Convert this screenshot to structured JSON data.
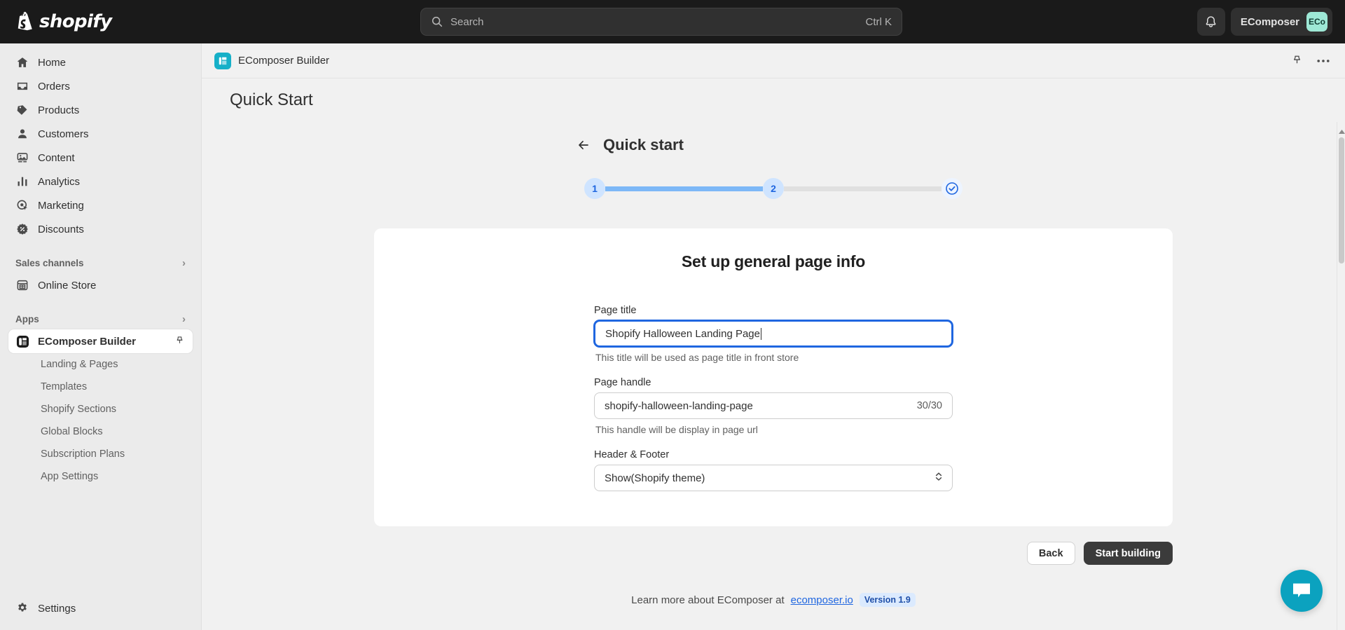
{
  "topbar": {
    "brand": "shopify",
    "search": {
      "placeholder": "Search",
      "shortcut": "Ctrl K",
      "icon": "search-icon"
    },
    "notifications_icon": "bell-icon",
    "account": {
      "name": "EComposer",
      "initials": "ECo"
    }
  },
  "sidebar": {
    "items": [
      {
        "label": "Home",
        "icon": "home-icon"
      },
      {
        "label": "Orders",
        "icon": "orders-inbox-icon"
      },
      {
        "label": "Products",
        "icon": "tag-icon"
      },
      {
        "label": "Customers",
        "icon": "person-icon"
      },
      {
        "label": "Content",
        "icon": "image-icon"
      },
      {
        "label": "Analytics",
        "icon": "bar-chart-icon"
      },
      {
        "label": "Marketing",
        "icon": "target-click-icon"
      },
      {
        "label": "Discounts",
        "icon": "discount-badge-icon"
      }
    ],
    "sales_channels": {
      "label": "Sales channels",
      "chevron": "chevron-right-icon"
    },
    "online_store": {
      "label": "Online Store",
      "icon": "storefront-icon"
    },
    "apps": {
      "label": "Apps",
      "chevron": "chevron-right-icon"
    },
    "active_app": {
      "label": "EComposer Builder",
      "icon": "ecomposer-logo-icon",
      "pin": "pin-icon"
    },
    "app_subitems": [
      {
        "label": "Landing & Pages"
      },
      {
        "label": "Templates"
      },
      {
        "label": "Shopify Sections"
      },
      {
        "label": "Global Blocks"
      },
      {
        "label": "Subscription Plans"
      },
      {
        "label": "App Settings"
      }
    ],
    "settings": {
      "label": "Settings",
      "icon": "gear-icon"
    }
  },
  "appbar": {
    "title": "EComposer Builder",
    "app_icon": "ecomposer-logo-icon",
    "pin_icon": "pin-icon",
    "more_icon": "ellipsis-horizontal-icon"
  },
  "page": {
    "title": "Quick Start",
    "quick_start_heading": "Quick start",
    "back_icon": "arrow-left-icon"
  },
  "stepper": {
    "steps": [
      {
        "label": "1",
        "state": "active"
      },
      {
        "label": "2",
        "state": "active"
      }
    ],
    "final_icon": "check-circle-icon",
    "bar_done_color": "#7db8f7",
    "bar_todo_color": "#e0e0e0",
    "circle_bg": "#cfe4ff",
    "circle_fg": "#1f66e0"
  },
  "card": {
    "heading": "Set up general page info",
    "page_title_field": {
      "label": "Page title",
      "value": "Shopify Halloween Landing Page",
      "help": "This title will be used as page title in front store",
      "focused": true
    },
    "page_handle_field": {
      "label": "Page handle",
      "value": "shopify-halloween-landing-page",
      "counter": "30/30",
      "help": "This handle will be display in page url"
    },
    "header_footer_field": {
      "label": "Header & Footer",
      "value": "Show(Shopify theme)",
      "chevron": "chevron-updown-icon"
    }
  },
  "actions": {
    "back_label": "Back",
    "primary_label": "Start building"
  },
  "footer": {
    "text": "Learn more about EComposer at",
    "link": "ecomposer.io",
    "version": "Version 1.9"
  },
  "chat": {
    "icon": "chat-bubble-icon",
    "color": "#0ba2bf"
  }
}
